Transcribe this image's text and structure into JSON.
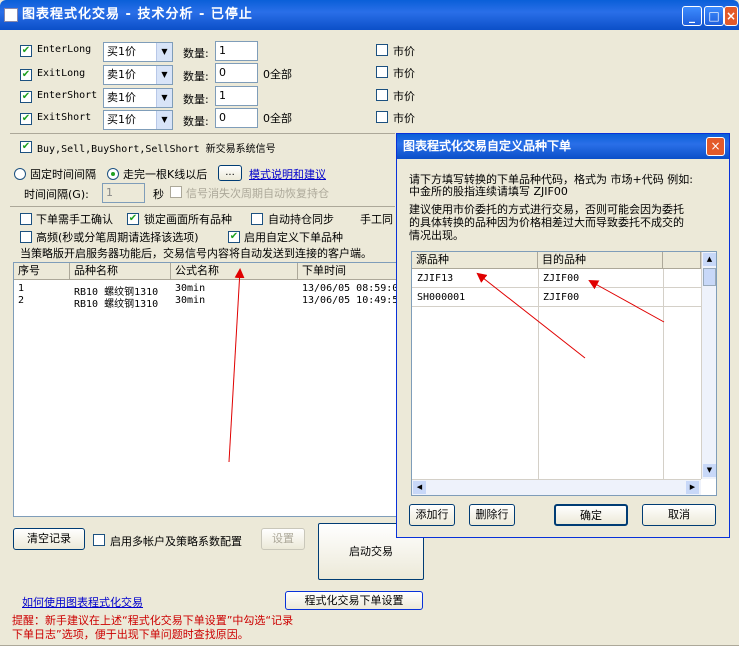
{
  "window": {
    "title": "图表程式化交易 - 技术分析 - 已停止",
    "minimize": "_",
    "maximize": "□",
    "close": "×"
  },
  "signals": [
    {
      "name": "EnterLong",
      "order": "买1价",
      "qty_label": "数量:",
      "qty": "1",
      "extra": "",
      "market_label": "市价"
    },
    {
      "name": "ExitLong",
      "order": "卖1价",
      "qty_label": "数量:",
      "qty": "0",
      "extra": "0全部",
      "market_label": "市价"
    },
    {
      "name": "EnterShort",
      "order": "卖1价",
      "qty_label": "数量:",
      "qty": "1",
      "extra": "",
      "market_label": "市价"
    },
    {
      "name": "ExitShort",
      "order": "买1价",
      "qty_label": "数量:",
      "qty": "0",
      "extra": "0全部",
      "market_label": "市价"
    }
  ],
  "new_signal_label": "Buy,Sell,BuyShort,SellShort 新交易系统信号",
  "timing": {
    "fixed": "固定时间间隔",
    "bar": "走完一根K线以后",
    "more": "...",
    "help_link": "模式说明和建议",
    "interval_label": "时间间隔(G):",
    "interval_value": "1",
    "unit": "秒",
    "recover": "信号消失次周期自动恢复持仓"
  },
  "options": {
    "manual": "下单需手工确认",
    "lock": "锁定画面所有品种",
    "auto_sync": "自动持仓同步",
    "manual_same": "手工同",
    "hf": "高频(秒或分笔周期请选择该选项)",
    "custom": "启用自定义下单品种"
  },
  "notice": "当策略版开启服务器功能后，交易信号内容将自动发送到连接的客户端。",
  "log": {
    "columns": [
      "序号",
      "品种名称",
      "公式名称",
      "下单时间"
    ],
    "rows": [
      [
        "1",
        "RB10 螺纹钢1310",
        "30min",
        "13/06/05 08:59:0"
      ],
      [
        "2",
        "RB10 螺纹钢1310",
        "30min",
        "13/06/05 10:49:5"
      ]
    ]
  },
  "bottom": {
    "clear": "清空记录",
    "multi": "启用多帐户及策略系数配置",
    "settings": "设置",
    "start": "启动交易",
    "howto_link": "如何使用图表程式化交易",
    "order_settings": "程式化交易下单设置"
  },
  "tip": {
    "line1": "提醒：新手建议在上述“程式化交易下单设置”中勾选“记录",
    "line2": "下单日志”选项，便于出现下单问题时查找原因。"
  },
  "dialog": {
    "title": "图表程式化交易自定义品种下单",
    "close": "×",
    "desc1": "请下方填写转换的下单品种代码，格式为 市场+代码 例如:",
    "desc2": "中金所的股指连续请填写 ZJIF00",
    "desc3": "建议使用市价委托的方式进行交易，否则可能会因为委托",
    "desc4": "的具体转换的品种因为价格相差过大而导致委托不成交的",
    "desc5": "情况出现。",
    "columns": [
      "源品种",
      "目的品种"
    ],
    "rows": [
      [
        "ZJIF13",
        "ZJIF00"
      ],
      [
        "SH000001",
        "ZJIF00"
      ]
    ],
    "add": "添加行",
    "delete": "删除行",
    "ok": "确定",
    "cancel": "取消"
  },
  "colors": {
    "title_blue": "#0a5fd8",
    "link": "#0000cc",
    "tip_red": "#cc0000",
    "arrow_red": "#e00000"
  }
}
